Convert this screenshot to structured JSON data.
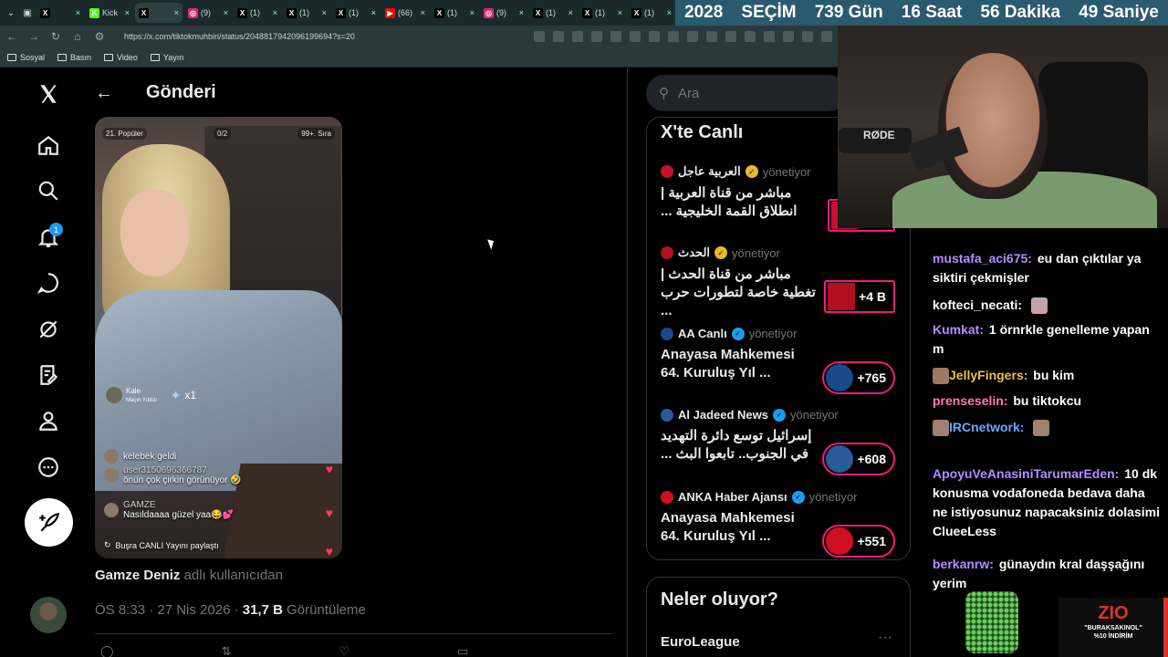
{
  "browser": {
    "tabs": [
      {
        "label": "",
        "icon": "x-logo-icon",
        "color": "#000000"
      },
      {
        "label": "Kick",
        "icon": "kick-icon",
        "color": "#53fc18"
      },
      {
        "label": "",
        "icon": "x-logo-icon",
        "color": "#000000"
      },
      {
        "label": "(9)",
        "icon": "instagram-icon",
        "color": "#d62976"
      },
      {
        "label": "(1)",
        "icon": "x-logo-icon",
        "color": "#000000"
      },
      {
        "label": "(1)",
        "icon": "x-logo-icon",
        "color": "#000000"
      },
      {
        "label": "(1)",
        "icon": "x-logo-icon",
        "color": "#000000"
      },
      {
        "label": "(66)",
        "icon": "youtube-icon",
        "color": "#ff0000"
      },
      {
        "label": "(1)",
        "icon": "x-logo-icon",
        "color": "#000000"
      },
      {
        "label": "(9)",
        "icon": "instagram-icon",
        "color": "#d62976"
      },
      {
        "label": "(1)",
        "icon": "x-logo-icon",
        "color": "#000000"
      },
      {
        "label": "(1)",
        "icon": "x-logo-icon",
        "color": "#000000"
      },
      {
        "label": "(1)",
        "icon": "x-logo-icon",
        "color": "#000000"
      }
    ],
    "url": "https://x.com/tiktokmuhbiri/status/2048817942096199694?s=20",
    "bookmarks": [
      "Sosyal",
      "Basın",
      "Video",
      "Yayın"
    ]
  },
  "countdown": {
    "year": "2028",
    "label": "SEÇİM",
    "days": "739 Gün",
    "hours": "16 Saat",
    "minutes": "56 Dakika",
    "seconds": "49 Saniye"
  },
  "x_nav": {
    "notification_count": "1",
    "icons": [
      "x-logo-icon",
      "home-icon",
      "search-icon",
      "bell-icon",
      "chat-icon",
      "grok-icon",
      "bookmark-icon",
      "profile-icon",
      "more-icon"
    ]
  },
  "post": {
    "header_title": "Gönderi",
    "video_overlay": {
      "top_left": "21. Popüler",
      "top_mid": "0/2",
      "top_right": "99+. Sıra",
      "gift_user": "Kale",
      "gift_sub": "Maçın Yıldızı",
      "gift_count": "x1",
      "comments": [
        {
          "user": "kelebek geldi",
          "text": ""
        },
        {
          "user": "user3150696366787",
          "text": "önün çok çirkin görünüyor 🤣"
        },
        {
          "user": "GAMZE",
          "text": "Nasıldaaaa güzel yaa😂💕"
        },
        {
          "user": "",
          "text": "Buşra CANLI Yayını paylaştı"
        }
      ]
    },
    "attribution_name": "Gamze Deniz",
    "attribution_suffix": "adlı kullanıcıdan",
    "time": "ÖS 8:33 · 27 Nis 2026 · ",
    "views": "31,7 B",
    "views_label": "Görüntüleme"
  },
  "right": {
    "search_placeholder": "Ara",
    "live_title": "X'te Canlı",
    "live_items": [
      {
        "host": "العربية عاجل",
        "role": "yönetiyor",
        "title": "مباشر من قناة العربية | انطلاق القمة الخليجية ...",
        "count": "",
        "rtl": true,
        "verified": "gold",
        "host_color": "#c8102e"
      },
      {
        "host": "الحدث",
        "role": "yönetiyor",
        "title": "مباشر من قناة الحدث | تغطية خاصة لتطورات حرب ...",
        "count": "+4 B",
        "rtl": true,
        "verified": "gold",
        "host_color": "#b01020"
      },
      {
        "host": "AA Canlı",
        "role": "yönetiyor",
        "title": "Anayasa Mahkemesi 64. Kuruluş Yıl ...",
        "count": "+765",
        "rtl": false,
        "verified": "blue",
        "host_color": "#1a4a8a"
      },
      {
        "host": "Al Jadeed News",
        "role": "yönetiyor",
        "title": "إسرائيل توسع دائرة التهديد في الجنوب.. تابعوا البث ...",
        "count": "+608",
        "rtl": true,
        "verified": "blue",
        "host_color": "#2a5a9a"
      },
      {
        "host": "ANKA Haber Ajansı",
        "role": "yönetiyor",
        "title": "Anayasa Mahkemesi 64. Kuruluş Yıl ...",
        "count": "+551",
        "rtl": false,
        "verified": "blue",
        "host_color": "#d01020"
      }
    ],
    "news_title": "Neler oluyor?",
    "news_first": "EuroLeague"
  },
  "stream": {
    "mic_brand": "RØDE",
    "chat": [
      {
        "user": "mustafa_aci675:",
        "text": "eu dan çıktılar ya siktiri çekmişler",
        "color": "#b48cff",
        "emote": ""
      },
      {
        "user": "kofteci_necati:",
        "text": "",
        "color": "#ffffff",
        "emote": "#c8a0a8"
      },
      {
        "user": "Kumkat:",
        "text": "1 örnrkle genelleme yapan m",
        "color": "#b48cff",
        "emote": ""
      },
      {
        "user": "JellyFingers:",
        "text": "bu kim",
        "color": "#e8c040",
        "emote": "#a07860"
      },
      {
        "user": "prenseselin:",
        "text": "bu tiktokcu",
        "color": "#ff7ab0",
        "emote": ""
      },
      {
        "user": "IRCnetwork:",
        "text": "",
        "color": "#6aa8ff",
        "emote": "#a08070"
      },
      {
        "user": "ApoyuVeAnasiniTarumarEden:",
        "text": "10 dk konusma vodafoneda bedava daha ne istiyosunuz napacaksiniz dolasimi ClueeLess",
        "color": "#b48cff",
        "emote": ""
      },
      {
        "user": "berkanrw:",
        "text": "günaydın kral daşşağını yerim",
        "color": "#b48cff",
        "emote": ""
      }
    ],
    "sponsor_brand": "ZIO",
    "sponsor_line1": "\"BURAKSAKINOL\"",
    "sponsor_line2": "%10 İNDİRİM"
  }
}
